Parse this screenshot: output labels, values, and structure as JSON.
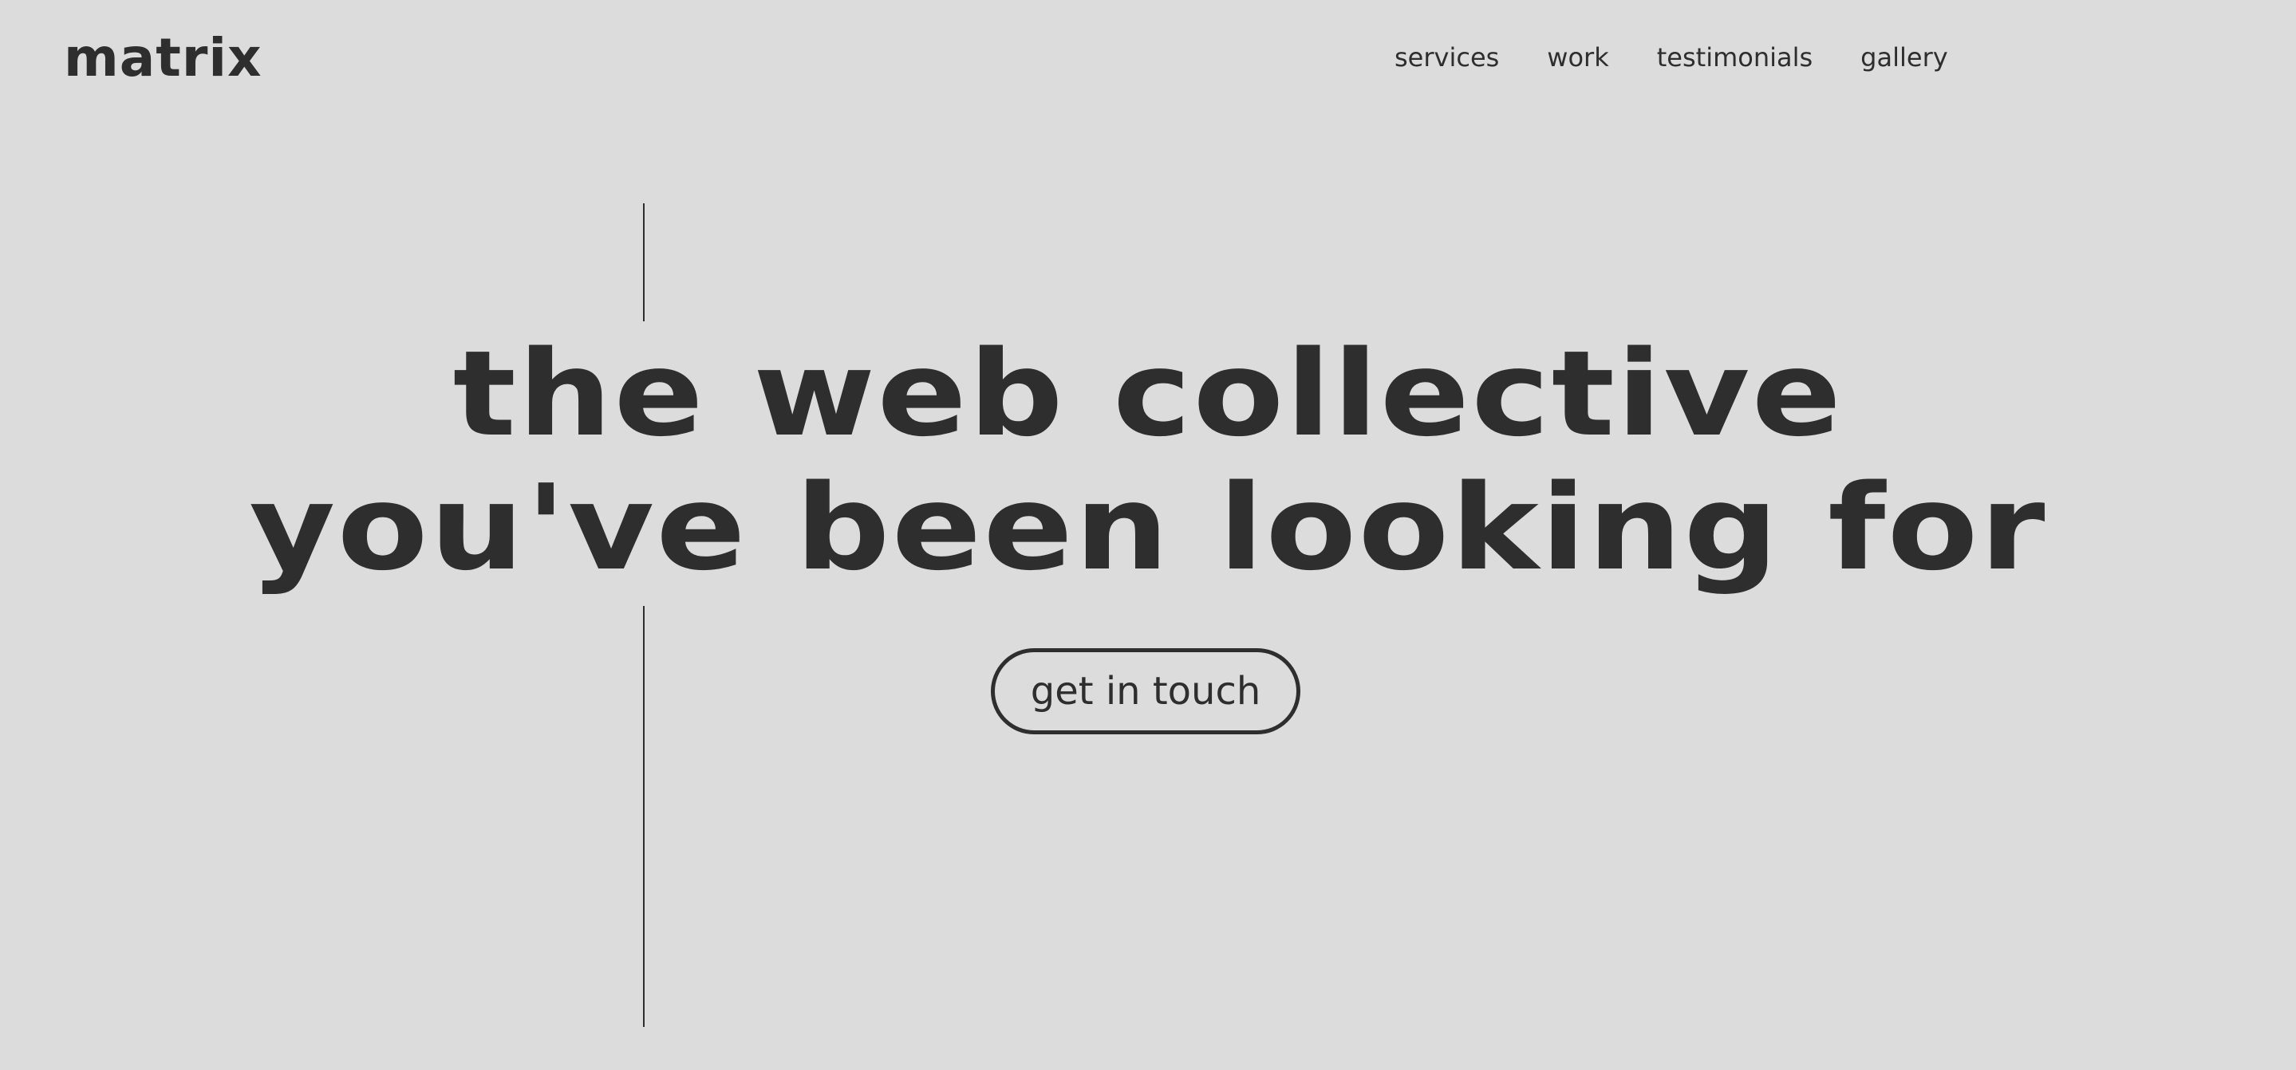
{
  "header": {
    "logo": "matrix",
    "nav": [
      "services",
      "work",
      "testimonials",
      "gallery"
    ]
  },
  "hero": {
    "line1": "the web collective",
    "line2": "you've been looking for",
    "cta_label": "get in touch"
  },
  "colors": {
    "background": "#dcdcdc",
    "text": "#2e2e2e"
  }
}
